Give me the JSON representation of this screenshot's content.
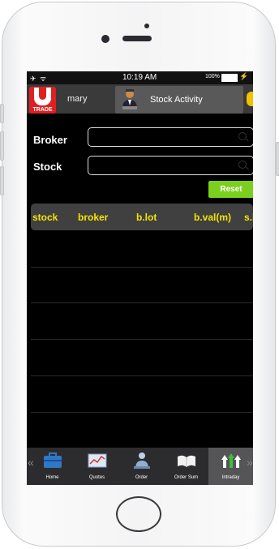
{
  "status_bar": {
    "signal": "✈ ᯤ",
    "time": "10:19 AM",
    "battery": "100%",
    "charging": "⚡"
  },
  "nav": {
    "logo_text": "TRADE",
    "prev_tab": "mary",
    "active_tab": "Stock Activity"
  },
  "form": {
    "broker_label": "Broker",
    "broker_value": "",
    "stock_label": "Stock",
    "stock_value": "",
    "reset_label": "Reset"
  },
  "table": {
    "columns": [
      "stock",
      "broker",
      "b.lot",
      "b.val(m)",
      "s.l"
    ],
    "rows": []
  },
  "tabbar": {
    "left_arrow": "«",
    "right_arrow": "»",
    "items": [
      {
        "label": "Home",
        "icon": "home-briefcase-icon"
      },
      {
        "label": "Quotes",
        "icon": "quotes-chart-icon"
      },
      {
        "label": "Order",
        "icon": "order-person-icon"
      },
      {
        "label": "Order Sum",
        "icon": "order-sum-book-icon"
      },
      {
        "label": "Intraday",
        "icon": "intraday-arrows-icon"
      }
    ],
    "active_index": 4
  },
  "colors": {
    "accent_yellow": "#f4e400",
    "reset_green": "#7bd01d",
    "logo_red": "#e02020"
  }
}
